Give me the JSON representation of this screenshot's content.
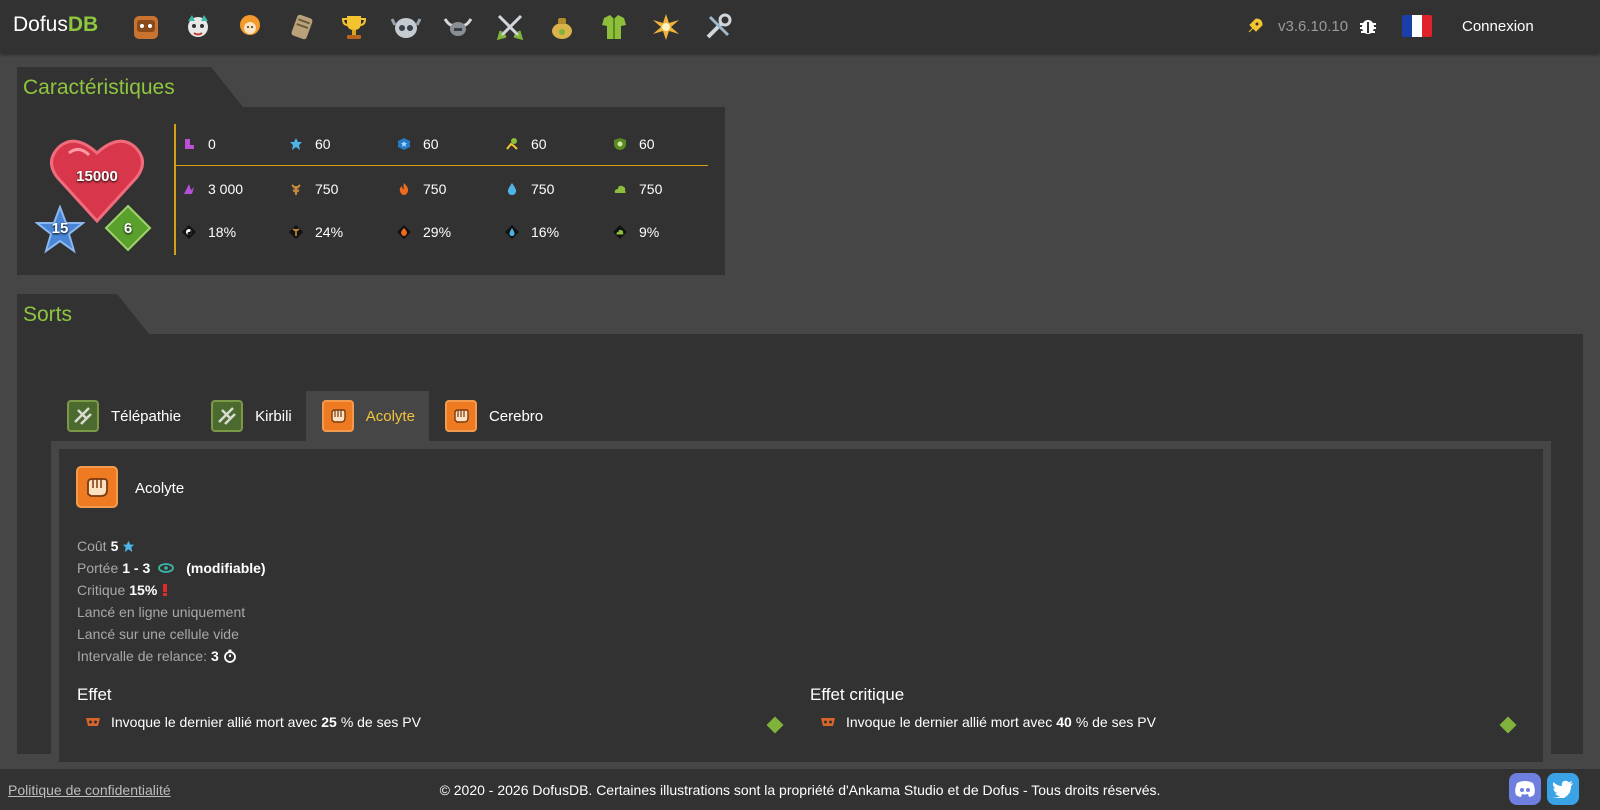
{
  "header": {
    "brand_prefix": "Dofus",
    "brand_suffix": "DB",
    "nav_icons": [
      "chest-icon",
      "creature-icon",
      "character-icon",
      "scroll-icon",
      "trophy-icon",
      "skull-helmet-icon",
      "horned-helmet-icon",
      "crossed-swords-icon",
      "bag-icon",
      "armor-icon",
      "explosion-icon",
      "tools-icon"
    ],
    "version": "v3.6.10.10",
    "login_label": "Connexion"
  },
  "characteristics": {
    "title": "Caractéristiques",
    "life": "15000",
    "level": "15",
    "pm": "6",
    "row1": [
      {
        "icon": "boot-icon",
        "value": "0"
      },
      {
        "icon": "ap-star-icon",
        "value": "60"
      },
      {
        "icon": "blue-star-icon",
        "value": "60"
      },
      {
        "icon": "dodge-icon",
        "value": "60"
      },
      {
        "icon": "shield-icon",
        "value": "60"
      }
    ],
    "row2": [
      {
        "icon": "neutral-damage-icon",
        "value": "3 000"
      },
      {
        "icon": "earth-icon",
        "value": "750"
      },
      {
        "icon": "fire-icon",
        "value": "750"
      },
      {
        "icon": "water-icon",
        "value": "750"
      },
      {
        "icon": "air-icon",
        "value": "750"
      }
    ],
    "row3": [
      {
        "icon": "neutral-resist-icon",
        "value": "18%"
      },
      {
        "icon": "earth-resist-icon",
        "value": "24%"
      },
      {
        "icon": "fire-resist-icon",
        "value": "29%"
      },
      {
        "icon": "water-resist-icon",
        "value": "16%"
      },
      {
        "icon": "air-resist-icon",
        "value": "9%"
      }
    ]
  },
  "spells": {
    "title": "Sorts",
    "tabs": [
      {
        "label": "Télépathie",
        "style": "green"
      },
      {
        "label": "Kirbili",
        "style": "green"
      },
      {
        "label": "Acolyte",
        "style": "orange",
        "active": true
      },
      {
        "label": "Cerebro",
        "style": "orange"
      }
    ],
    "selected": {
      "name": "Acolyte",
      "cost_label": "Coût",
      "cost_value": "5",
      "range_label": "Portée",
      "range_value": "1 - 3",
      "range_note": "(modifiable)",
      "crit_label": "Critique",
      "crit_value": "15%",
      "line_only": "Lancé en ligne uniquement",
      "empty_cell": "Lancé sur une cellule vide",
      "cooldown_label": "Intervalle de relance:",
      "cooldown_value": "3",
      "effect_title": "Effet",
      "effect_pre": "Invoque le dernier allié mort avec",
      "effect_value": "25",
      "effect_post": "% de ses PV",
      "crit_effect_title": "Effet critique",
      "crit_effect_pre": "Invoque le dernier allié mort avec",
      "crit_effect_value": "40",
      "crit_effect_post": "% de ses PV"
    }
  },
  "footer": {
    "privacy": "Politique de confidentialité",
    "copyright": "© 2020 - 2026 DofusDB. Certaines illustrations sont la propriété d'Ankama Studio et de Dofus - Tous droits réservés."
  },
  "colors": {
    "accent_green": "#8ec63f",
    "gold_line": "#d4a017",
    "active_tab": "#f0c33c",
    "panel": "#323232",
    "background": "#464646"
  }
}
